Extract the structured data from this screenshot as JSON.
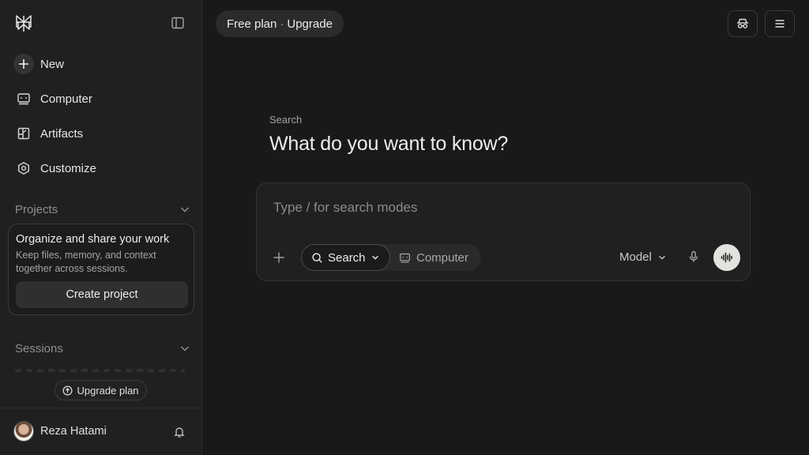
{
  "sidebar": {
    "nav": [
      {
        "label": "New",
        "icon": "plus-icon"
      },
      {
        "label": "Computer",
        "icon": "computer-icon"
      },
      {
        "label": "Artifacts",
        "icon": "artifacts-icon"
      },
      {
        "label": "Customize",
        "icon": "hexagon-icon"
      }
    ],
    "projects": {
      "label": "Projects",
      "card_title": "Organize and share your work",
      "card_desc": "Keep files, memory, and context together across sessions.",
      "create_label": "Create project"
    },
    "sessions": {
      "label": "Sessions"
    },
    "upgrade_label": "Upgrade plan",
    "user": {
      "name": "Reza Hatami"
    }
  },
  "header": {
    "plan_label": "Free plan",
    "separator": "·",
    "upgrade_label": "Upgrade"
  },
  "main": {
    "label": "Search",
    "title": "What do you want to know?",
    "input": {
      "placeholder": "Type / for search modes",
      "value": ""
    },
    "modes": {
      "search": "Search",
      "computer": "Computer"
    },
    "model_label": "Model"
  },
  "colors": {
    "background": "#191919",
    "sidebar": "#202020",
    "text": "#e8e8e6",
    "muted": "#8f8f8b",
    "voice_button": "#e2e2df"
  }
}
